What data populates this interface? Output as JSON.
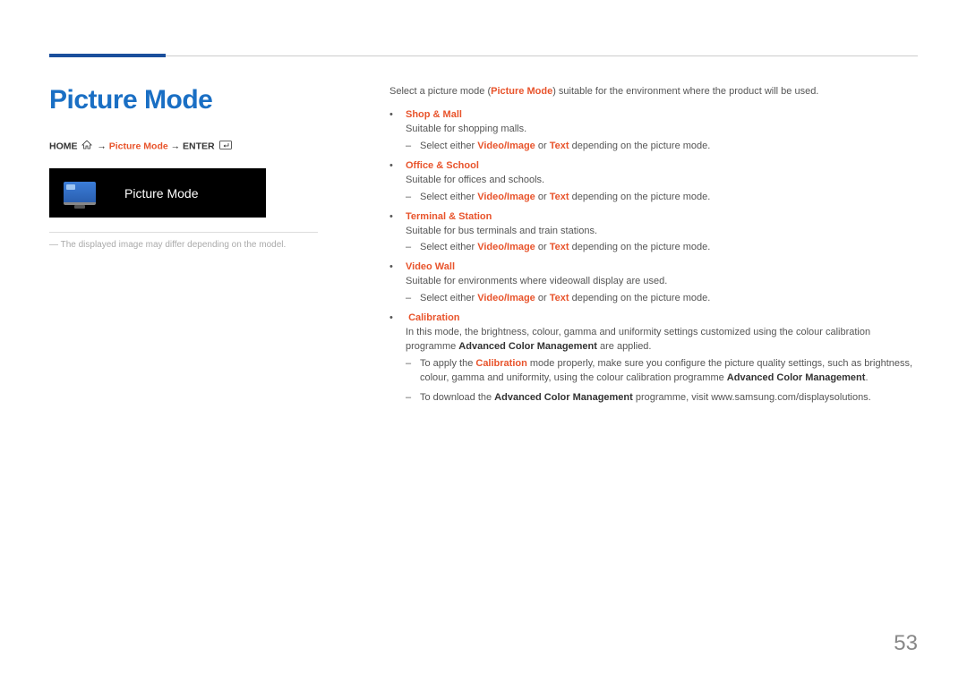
{
  "page_title": "Picture Mode",
  "breadcrumb": {
    "home": "HOME",
    "arrow1": " → ",
    "mid": "Picture Mode",
    "arrow2": " → ",
    "enter": "ENTER"
  },
  "preview_label": "Picture Mode",
  "caption": "The displayed image may differ depending on the model.",
  "intro_prefix": "Select a picture mode (",
  "intro_bold": "Picture Mode",
  "intro_suffix": ") suitable for the environment where the product will be used.",
  "modes": [
    {
      "title": "Shop & Mall",
      "desc": "Suitable for shopping malls.",
      "sub_type": "select",
      "sub_prefix": "Select either ",
      "sub_opt1": "Video/Image",
      "sub_or": " or ",
      "sub_opt2": "Text",
      "sub_suffix": " depending on the picture mode."
    },
    {
      "title": "Office & School",
      "desc": "Suitable for offices and schools.",
      "sub_type": "select",
      "sub_prefix": "Select either ",
      "sub_opt1": "Video/Image",
      "sub_or": " or ",
      "sub_opt2": "Text",
      "sub_suffix": " depending on the picture mode."
    },
    {
      "title": "Terminal & Station",
      "desc": "Suitable for bus terminals and train stations.",
      "sub_type": "select",
      "sub_prefix": "Select either ",
      "sub_opt1": "Video/Image",
      "sub_or": " or ",
      "sub_opt2": "Text",
      "sub_suffix": " depending on the picture mode."
    },
    {
      "title": "Video Wall",
      "desc": "Suitable for environments where videowall display are used.",
      "sub_type": "select",
      "sub_prefix": "Select either ",
      "sub_opt1": "Video/Image",
      "sub_or": " or ",
      "sub_opt2": "Text",
      "sub_suffix": " depending on the picture mode."
    }
  ],
  "calibration": {
    "title": "Calibration",
    "desc_prefix": "In this mode, the brightness, colour, gamma and uniformity settings customized using the colour calibration programme ",
    "desc_bold": "Advanced Color Management",
    "desc_suffix": " are applied.",
    "sub1_prefix": "To apply the ",
    "sub1_accent": "Calibration",
    "sub1_mid": " mode properly, make sure you configure the picture quality settings, such as brightness, colour, gamma and uniformity, using the colour calibration programme ",
    "sub1_bold": "Advanced Color Management",
    "sub1_suffix": ".",
    "sub2_prefix": "To download the ",
    "sub2_bold": "Advanced Color Management",
    "sub2_suffix": " programme, visit www.samsung.com/displaysolutions."
  },
  "page_number": "53"
}
